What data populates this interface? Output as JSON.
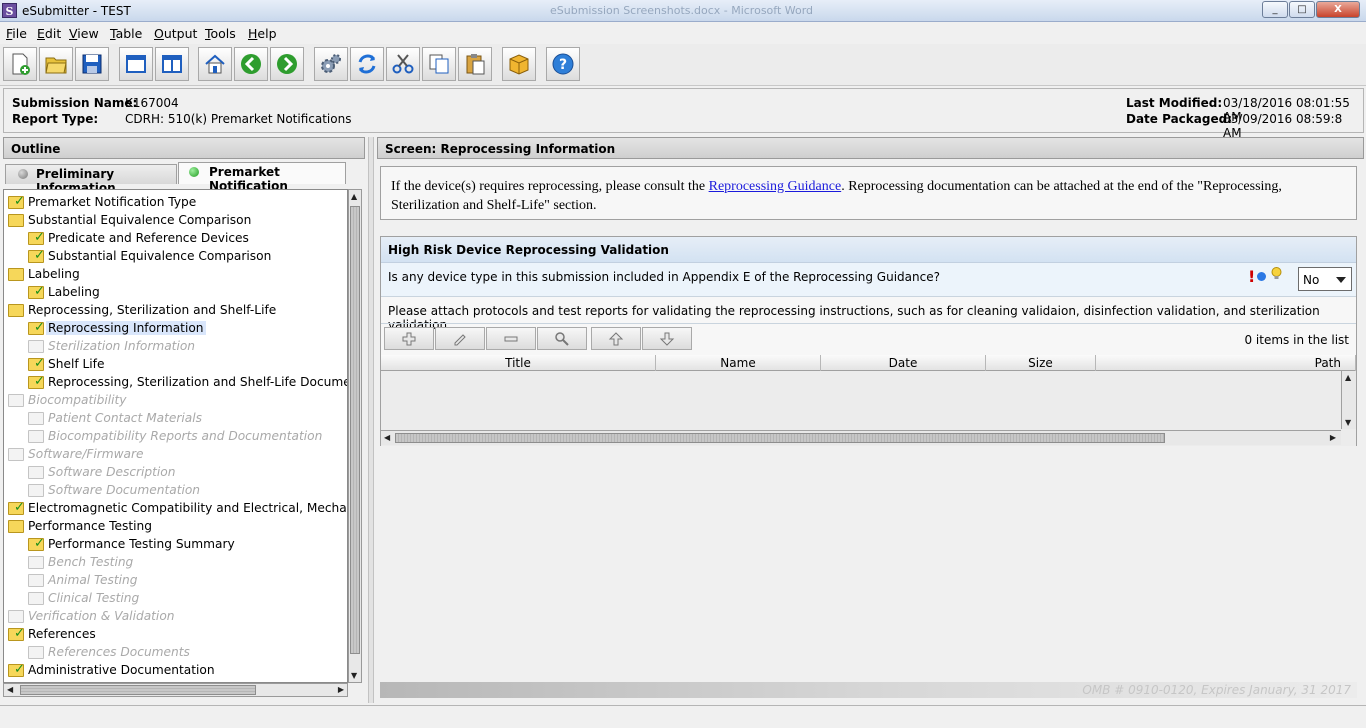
{
  "window": {
    "title": "eSubmitter - TEST",
    "app_icon_letter": "S",
    "background_caption": "eSubmission Screenshots.docx - Microsoft Word",
    "min_label": "_",
    "max_label": "□",
    "close_label": "X"
  },
  "menu": [
    "File",
    "Edit",
    "View",
    "Table",
    "Output",
    "Tools",
    "Help"
  ],
  "toolbar": {
    "icons": [
      "new-document-icon",
      "open-folder-icon",
      "save-icon",
      "single-window-icon",
      "split-window-icon",
      "home-icon",
      "back-icon",
      "forward-icon",
      "settings-icon",
      "refresh-icon",
      "cut-icon",
      "copy-icon",
      "paste-icon",
      "package-icon",
      "help-icon"
    ]
  },
  "info": {
    "submission_name_label": "Submission Name:",
    "submission_name": "K167004",
    "report_type_label": "Report Type:",
    "report_type": "CDRH: 510(k) Premarket Notifications",
    "last_modified_label": "Last Modified:",
    "last_modified": "03/18/2016 08:01:55 AM",
    "date_packaged_label": "Date Packaged:",
    "date_packaged": "03/09/2016 08:59:8 AM"
  },
  "outline": {
    "title": "Outline",
    "tabs": [
      {
        "label": "Preliminary Information",
        "status_color": "#8c8c8c"
      },
      {
        "label": "Premarket Notification",
        "status_color": "#2ca02c"
      }
    ],
    "tree": [
      {
        "label": "Premarket Notification Type",
        "level": 0,
        "state": "checked"
      },
      {
        "label": "Substantial Equivalence Comparison",
        "level": 0,
        "state": "folder"
      },
      {
        "label": "Predicate and Reference Devices",
        "level": 1,
        "state": "checked"
      },
      {
        "label": "Substantial Equivalence Comparison",
        "level": 1,
        "state": "checked"
      },
      {
        "label": "Labeling",
        "level": 0,
        "state": "folder"
      },
      {
        "label": "Labeling",
        "level": 1,
        "state": "checked"
      },
      {
        "label": "Reprocessing, Sterilization and Shelf-Life",
        "level": 0,
        "state": "folder"
      },
      {
        "label": "Reprocessing Information",
        "level": 1,
        "state": "checked",
        "selected": true
      },
      {
        "label": "Sterilization Information",
        "level": 1,
        "state": "disabled"
      },
      {
        "label": "Shelf Life",
        "level": 1,
        "state": "checked"
      },
      {
        "label": "Reprocessing, Sterilization and Shelf-Life Documentat",
        "level": 1,
        "state": "checked"
      },
      {
        "label": "Biocompatibility",
        "level": 0,
        "state": "disabled"
      },
      {
        "label": "Patient Contact Materials",
        "level": 1,
        "state": "disabled"
      },
      {
        "label": "Biocompatibility Reports and Documentation",
        "level": 1,
        "state": "disabled"
      },
      {
        "label": "Software/Firmware",
        "level": 0,
        "state": "disabled"
      },
      {
        "label": "Software Description",
        "level": 1,
        "state": "disabled"
      },
      {
        "label": "Software Documentation",
        "level": 1,
        "state": "disabled"
      },
      {
        "label": "Electromagnetic Compatibility and Electrical, Mechanical a",
        "level": 0,
        "state": "checked"
      },
      {
        "label": "Performance Testing",
        "level": 0,
        "state": "folder"
      },
      {
        "label": "Performance Testing Summary",
        "level": 1,
        "state": "checked"
      },
      {
        "label": "Bench Testing",
        "level": 1,
        "state": "disabled"
      },
      {
        "label": "Animal Testing",
        "level": 1,
        "state": "disabled"
      },
      {
        "label": "Clinical Testing",
        "level": 1,
        "state": "disabled"
      },
      {
        "label": "Verification & Validation",
        "level": 0,
        "state": "disabled"
      },
      {
        "label": "References",
        "level": 0,
        "state": "checked"
      },
      {
        "label": "References Documents",
        "level": 1,
        "state": "disabled"
      },
      {
        "label": "Administrative Documentation",
        "level": 0,
        "state": "checked"
      }
    ]
  },
  "screen": {
    "title": "Screen: Reprocessing Information",
    "intro_before": "If the device(s) requires reprocessing, please consult the ",
    "intro_link": "Reprocessing Guidance",
    "intro_after": ". Reprocessing documentation can be attached at the end of the \"Reprocessing, Sterilization and Shelf-Life\" section.",
    "section_title": "High Risk Device Reprocessing Validation",
    "question": "Is any device type in this submission included in Appendix E of the Reprocessing Guidance?",
    "answer": "No",
    "attach_text": "Please attach protocols and test reports for validating the reprocessing instructions, such as for cleaning validaion, disinfection validation, and sterilization validation.",
    "item_count": "0 items in the list",
    "columns": [
      "Title",
      "Name",
      "Date",
      "Size",
      "Path"
    ],
    "list_buttons": [
      "add-icon",
      "edit-icon",
      "remove-icon",
      "view-icon",
      "move-up-icon",
      "move-down-icon"
    ],
    "footer": "OMB # 0910-0120, Expires January, 31 2017"
  }
}
